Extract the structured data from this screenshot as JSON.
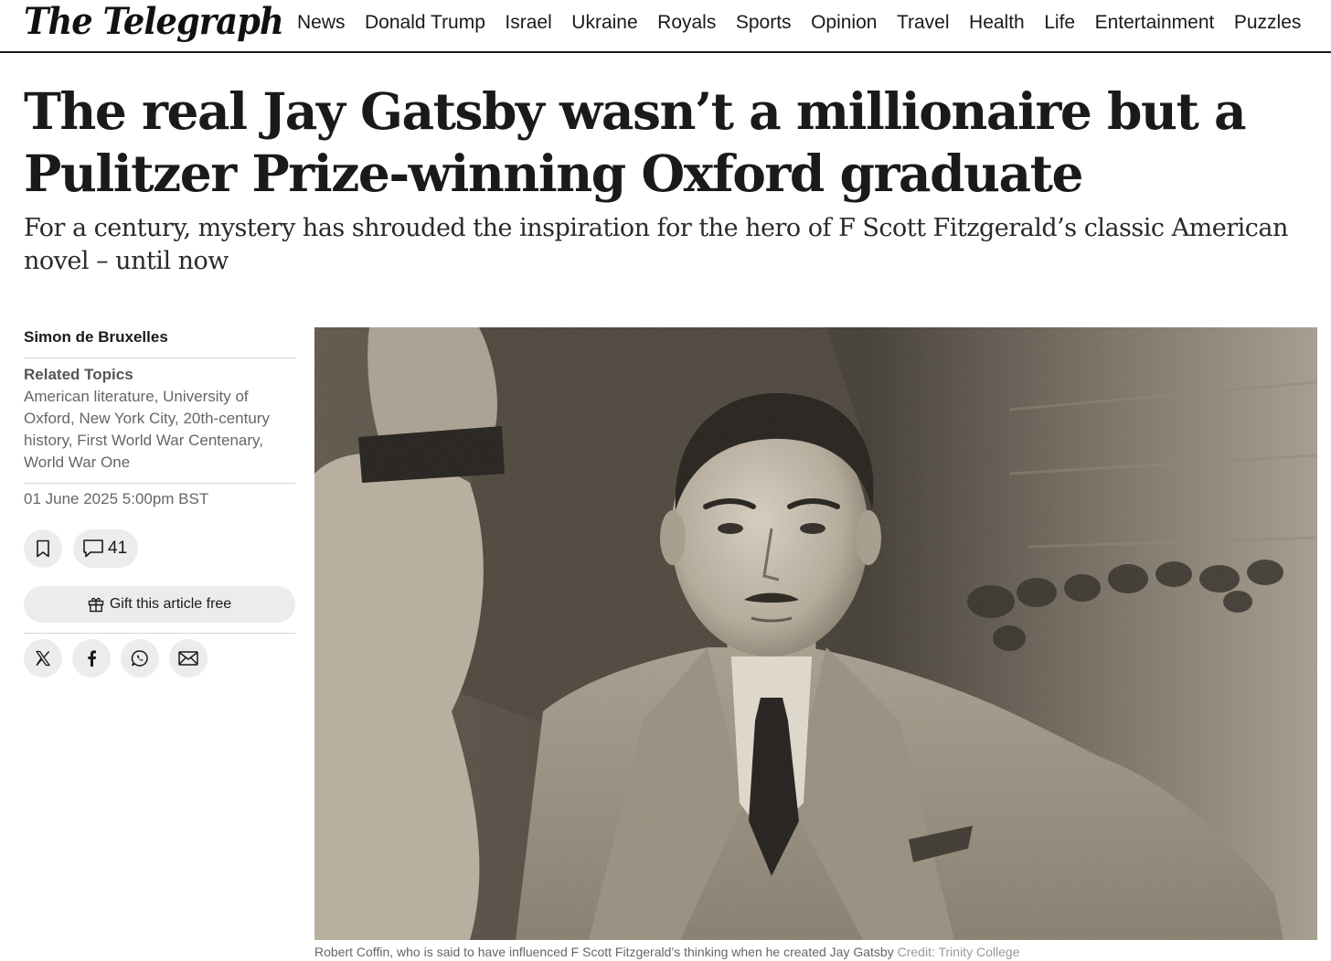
{
  "header": {
    "logo_text": "The Telegraph",
    "nav_items": [
      "News",
      "Donald Trump",
      "Israel",
      "Ukraine",
      "Royals",
      "Sports",
      "Opinion",
      "Travel",
      "Health",
      "Life",
      "Entertainment",
      "Puzzles"
    ]
  },
  "article": {
    "headline_line1": "The real Jay Gatsby wasn’t a millionaire but a",
    "headline_line2": "Pulitzer Prize-winning Oxford graduate",
    "standfirst": "For a century, mystery has shrouded the inspiration for the hero of F Scott Fitzgerald’s classic American novel – until now"
  },
  "sidebar": {
    "author": "Simon de Bruxelles",
    "topics_title": "Related Topics",
    "topics_text": "American literature, University of Oxford, New York City, 20th-century history, First World War Centenary, World War One",
    "date": "01 June 2025 5:00pm BST",
    "comment_count": "41",
    "gift_label": "Gift this article free",
    "share_icons": [
      "x-icon",
      "facebook-icon",
      "whatsapp-icon",
      "email-icon"
    ]
  },
  "image": {
    "caption": "Robert Coffin, who is said to have influenced F Scott Fitzgerald’s thinking when he created Jay Gatsby",
    "credit": "Credit: Trinity College"
  }
}
